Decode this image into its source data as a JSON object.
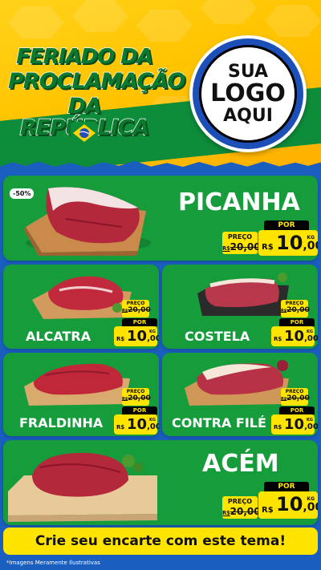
{
  "header": {
    "title_line1": "FERIADO DA",
    "title_line2": "PROCLAMAÇÃO",
    "title_line3": "DA REPÚBLICA",
    "logo_line1": "SUA",
    "logo_line2": "LOGO",
    "logo_line3": "AQUI"
  },
  "labels": {
    "preco": "PREÇO",
    "por": "POR",
    "currency": "R$",
    "unit": "KG"
  },
  "products": {
    "picanha": {
      "name": "PICANHA",
      "old_price": "20,00",
      "new_price_int": "10",
      "new_price_dec": ",00",
      "discount": "-50%"
    },
    "alcatra": {
      "name": "ALCATRA",
      "old_price": "20,00",
      "new_price_int": "10",
      "new_price_dec": ",00"
    },
    "costela": {
      "name": "COSTELA",
      "old_price": "20,00",
      "new_price_int": "10",
      "new_price_dec": ",00"
    },
    "fraldinha": {
      "name": "FRALDINHA",
      "old_price": "20,00",
      "new_price_int": "10",
      "new_price_dec": ",00"
    },
    "contra_file": {
      "name": "CONTRA FILÉ",
      "old_price": "20,00",
      "new_price_int": "10",
      "new_price_dec": ",00"
    },
    "acem": {
      "name": "ACÉM",
      "old_price": "20,00",
      "new_price_int": "10",
      "new_price_dec": ",00"
    }
  },
  "footer": {
    "cta": "Crie seu encarte com este tema!",
    "note": "*Imagens Meramente Ilustrativas"
  },
  "colors": {
    "green": "#179c3c",
    "blue": "#1a5fc0",
    "yellow": "#ffe400"
  }
}
